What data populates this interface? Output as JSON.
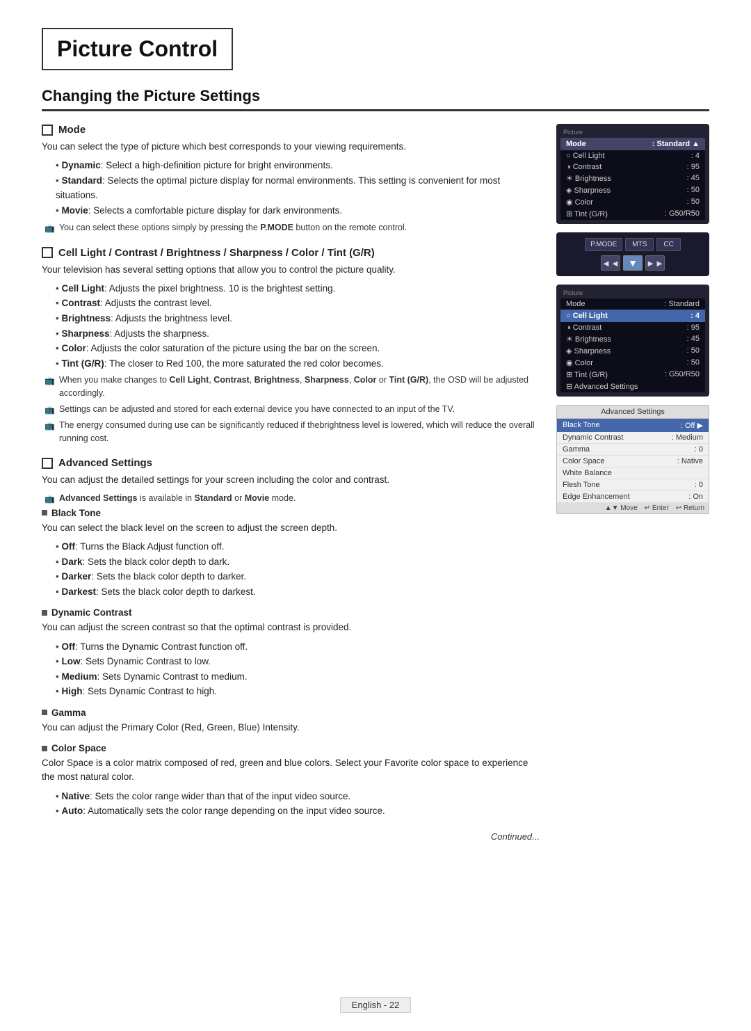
{
  "page": {
    "title": "Picture Control",
    "section_title": "Changing the Picture Settings",
    "footer_text": "English - 22",
    "continued_text": "Continued..."
  },
  "mode_section": {
    "header": "Mode",
    "body": "You can select the type of picture which best corresponds to your viewing requirements.",
    "bullets": [
      {
        "bold": "Dynamic",
        "text": ": Select a high-definition picture for bright environments."
      },
      {
        "bold": "Standard",
        "text": ": Selects the optimal picture display for normal environments. This setting is convenient for most situations."
      },
      {
        "bold": "Movie",
        "text": ": Selects a comfortable picture display for dark environments."
      }
    ],
    "note": "You can select these options simply by pressing the P.MODE button on the remote control."
  },
  "cell_light_section": {
    "header": "Cell Light / Contrast / Brightness / Sharpness / Color / Tint (G/R)",
    "body": "Your television has several setting options that allow you to control the picture quality.",
    "bullets": [
      {
        "bold": "Cell Light",
        "text": ": Adjusts the pixel brightness. 10 is the brightest setting."
      },
      {
        "bold": "Contrast",
        "text": ": Adjusts the contrast level."
      },
      {
        "bold": "Brightness",
        "text": ": Adjusts the brightness level."
      },
      {
        "bold": "Sharpness",
        "text": ": Adjusts the sharpness."
      },
      {
        "bold": "Color",
        "text": ": Adjusts the color saturation of the picture using the bar on the screen."
      },
      {
        "bold": "Tint (G/R)",
        "text": ": The closer to Red 100, the more saturated the red color becomes."
      }
    ],
    "notes": [
      "When you make changes to Cell Light, Contrast, Brightness, Sharpness, Color or Tint (G/R), the OSD will be adjusted accordingly.",
      "Settings can be adjusted and stored for each external device you have connected to an input of the TV.",
      "The energy consumed during use can be significantly reduced if thebrightness level is lowered, which will reduce the overall running cost."
    ]
  },
  "advanced_section": {
    "header": "Advanced Settings",
    "body": "You can adjust the detailed settings for your screen including the color and contrast.",
    "note": "Advanced Settings is available in Standard or Movie mode.",
    "subsections": [
      {
        "title": "Black Tone",
        "body": "You can select the black level on the screen to adjust the screen depth.",
        "bullets": [
          {
            "bold": "Off",
            "text": ": Turns the Black Adjust function off."
          },
          {
            "bold": "Dark",
            "text": ": Sets the black color depth to dark."
          },
          {
            "bold": "Darker",
            "text": ": Sets the black color depth to darker."
          },
          {
            "bold": "Darkest",
            "text": ": Sets the black color depth to darkest."
          }
        ]
      },
      {
        "title": "Dynamic Contrast",
        "body": "You can adjust the screen contrast so that the optimal contrast is provided.",
        "bullets": [
          {
            "bold": "Off",
            "text": ": Turns the Dynamic Contrast function off."
          },
          {
            "bold": "Low",
            "text": ": Sets Dynamic Contrast to low."
          },
          {
            "bold": "Medium",
            "text": ": Sets Dynamic Contrast to medium."
          },
          {
            "bold": "High",
            "text": ": Sets Dynamic Contrast to high."
          }
        ]
      },
      {
        "title": "Gamma",
        "body": "You can adjust the Primary Color (Red, Green, Blue) Intensity.",
        "bullets": []
      },
      {
        "title": "Color Space",
        "body": "Color Space is a color matrix composed of red, green and blue colors. Select your Favorite color space to experience the most natural color.",
        "bullets": [
          {
            "bold": "Native",
            "text": ": Sets the color range wider than that of the input video source."
          },
          {
            "bold": "Auto",
            "text": ": Automatically sets the color range depending on the input video source."
          }
        ]
      }
    ]
  },
  "tv_panel_1": {
    "sidebar_label": "Picture",
    "header_label": "Mode",
    "header_value": "Standard",
    "rows": [
      {
        "icon": "sun",
        "label": "Cell Light",
        "value": ": 4",
        "highlighted": false
      },
      {
        "icon": "contrast",
        "label": "Contrast",
        "value": ": 95",
        "highlighted": false
      },
      {
        "icon": "brightness",
        "label": "Brightness",
        "value": ": 45",
        "highlighted": false
      },
      {
        "icon": "sharpness",
        "label": "Sharpness",
        "value": ": 50",
        "highlighted": false
      },
      {
        "icon": "color",
        "label": "Color",
        "value": ": 50",
        "highlighted": false
      },
      {
        "icon": "tint",
        "label": "Tint (G/R)",
        "value": ": G50/R50",
        "highlighted": false
      }
    ]
  },
  "tv_panel_2": {
    "sidebar_label": "Picture",
    "header_label": "Mode",
    "header_value": "Standard",
    "rows": [
      {
        "icon": "",
        "label": "Mode",
        "value": ": Standard",
        "highlighted": false
      },
      {
        "icon": "sun",
        "label": "Cell Light",
        "value": ": 4",
        "highlighted": true
      },
      {
        "icon": "contrast",
        "label": "Contrast",
        "value": ": 95",
        "highlighted": false
      },
      {
        "icon": "brightness",
        "label": "Brightness",
        "value": ": 45",
        "highlighted": false
      },
      {
        "icon": "sharpness",
        "label": "Sharpness",
        "value": ": 50",
        "highlighted": false
      },
      {
        "icon": "color",
        "label": "Color",
        "value": ": 50",
        "highlighted": false
      },
      {
        "icon": "tint",
        "label": "Tint (G/R)",
        "value": ": G50/R50",
        "highlighted": false
      },
      {
        "icon": "",
        "label": "Advanced Settings",
        "value": "",
        "highlighted": false
      }
    ]
  },
  "remote": {
    "buttons": [
      "P.MODE",
      "MTS",
      "CC"
    ],
    "nav": [
      "◄◄",
      "▼",
      "►►"
    ]
  },
  "adv_panel": {
    "title": "Advanced Settings",
    "rows": [
      {
        "label": "Black Tone",
        "value": ": Off",
        "highlighted": true,
        "arrow": true
      },
      {
        "label": "Dynamic Contrast",
        "value": ": Medium",
        "highlighted": false
      },
      {
        "label": "Gamma",
        "value": ": 0",
        "highlighted": false
      },
      {
        "label": "Color Space",
        "value": ": Native",
        "highlighted": false
      },
      {
        "label": "White Balance",
        "value": "",
        "highlighted": false
      },
      {
        "label": "Flesh Tone",
        "value": ": 0",
        "highlighted": false
      },
      {
        "label": "Edge Enhancement",
        "value": ": On",
        "highlighted": false
      }
    ],
    "footer": [
      "▲▼ Move",
      "↵ Enter",
      "↩ Return"
    ]
  }
}
